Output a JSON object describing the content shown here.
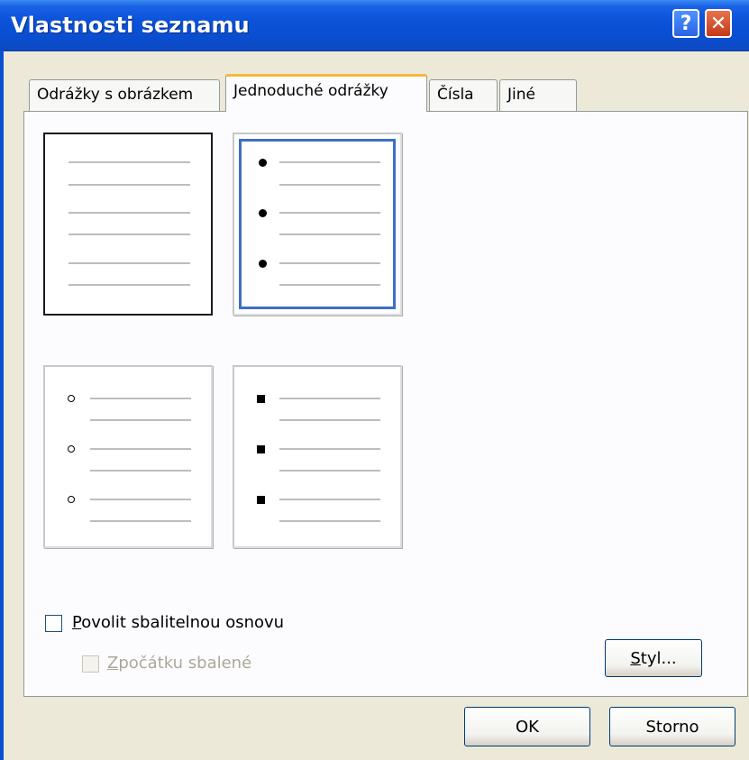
{
  "window": {
    "title": "Vlastnosti seznamu",
    "help_glyph": "?",
    "close_glyph": "✕"
  },
  "tabs": [
    {
      "label": "Odrážky s obrázkem",
      "active": false
    },
    {
      "label": "Jednoduché odrážky",
      "active": true
    },
    {
      "label": "Čísla",
      "active": false
    },
    {
      "label": "Jiné",
      "active": false
    }
  ],
  "bullet_styles": [
    {
      "style": "none",
      "selected": false
    },
    {
      "style": "disc",
      "selected": true
    },
    {
      "style": "circle",
      "selected": false
    },
    {
      "style": "square",
      "selected": false
    }
  ],
  "options": {
    "collapsible": {
      "label_first": "P",
      "label_rest": "ovolit sbalitelnou osnovu",
      "checked": false
    },
    "collapsed_initially": {
      "label_first": "Z",
      "label_rest": "počátku sbalené",
      "checked": false,
      "disabled": true
    }
  },
  "buttons": {
    "styl_first": "S",
    "styl_rest": "tyl...",
    "ok": "OK",
    "storno": "Storno"
  },
  "colors": {
    "titlebar": "#0a52d8",
    "selection_border": "#3e6fc4",
    "active_tab_accent": "#f6b83c",
    "close_button": "#c4381a"
  }
}
